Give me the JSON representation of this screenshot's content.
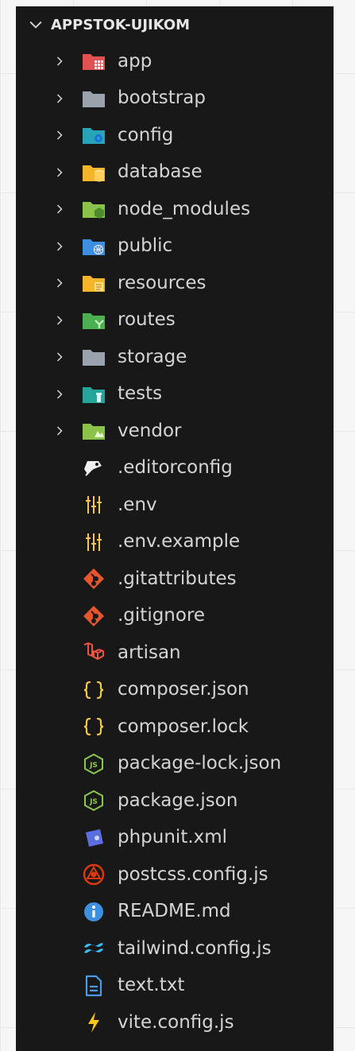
{
  "explorer": {
    "root_label": "APPSTOK-UJIKOM",
    "folders": [
      {
        "label": "app",
        "icon": "app-folder-icon",
        "color": "#e05252"
      },
      {
        "label": "bootstrap",
        "icon": "folder-icon",
        "color": "#9aa3ad"
      },
      {
        "label": "config",
        "icon": "config-folder-icon",
        "color": "#26a5b8"
      },
      {
        "label": "database",
        "icon": "database-folder-icon",
        "color": "#f5b52a"
      },
      {
        "label": "node_modules",
        "icon": "node-folder-icon",
        "color": "#8bc34a"
      },
      {
        "label": "public",
        "icon": "public-folder-icon",
        "color": "#3d8fe0"
      },
      {
        "label": "resources",
        "icon": "resources-folder-icon",
        "color": "#f5b52a"
      },
      {
        "label": "routes",
        "icon": "routes-folder-icon",
        "color": "#4caf50"
      },
      {
        "label": "storage",
        "icon": "folder-icon",
        "color": "#9aa3ad"
      },
      {
        "label": "tests",
        "icon": "tests-folder-icon",
        "color": "#26a69a"
      },
      {
        "label": "vendor",
        "icon": "vendor-folder-icon",
        "color": "#8bc34a"
      }
    ],
    "files": [
      {
        "label": ".editorconfig",
        "icon": "editorconfig-icon"
      },
      {
        "label": ".env",
        "icon": "env-icon"
      },
      {
        "label": ".env.example",
        "icon": "env-icon"
      },
      {
        "label": ".gitattributes",
        "icon": "git-icon"
      },
      {
        "label": ".gitignore",
        "icon": "git-icon"
      },
      {
        "label": "artisan",
        "icon": "laravel-icon"
      },
      {
        "label": "composer.json",
        "icon": "braces-icon"
      },
      {
        "label": "composer.lock",
        "icon": "braces-icon"
      },
      {
        "label": "package-lock.json",
        "icon": "nodejs-icon"
      },
      {
        "label": "package.json",
        "icon": "nodejs-icon"
      },
      {
        "label": "phpunit.xml",
        "icon": "phpunit-icon"
      },
      {
        "label": "postcss.config.js",
        "icon": "postcss-icon"
      },
      {
        "label": "README.md",
        "icon": "info-icon"
      },
      {
        "label": "tailwind.config.js",
        "icon": "tailwind-icon"
      },
      {
        "label": "text.txt",
        "icon": "text-file-icon"
      },
      {
        "label": "vite.config.js",
        "icon": "vite-icon"
      }
    ]
  }
}
